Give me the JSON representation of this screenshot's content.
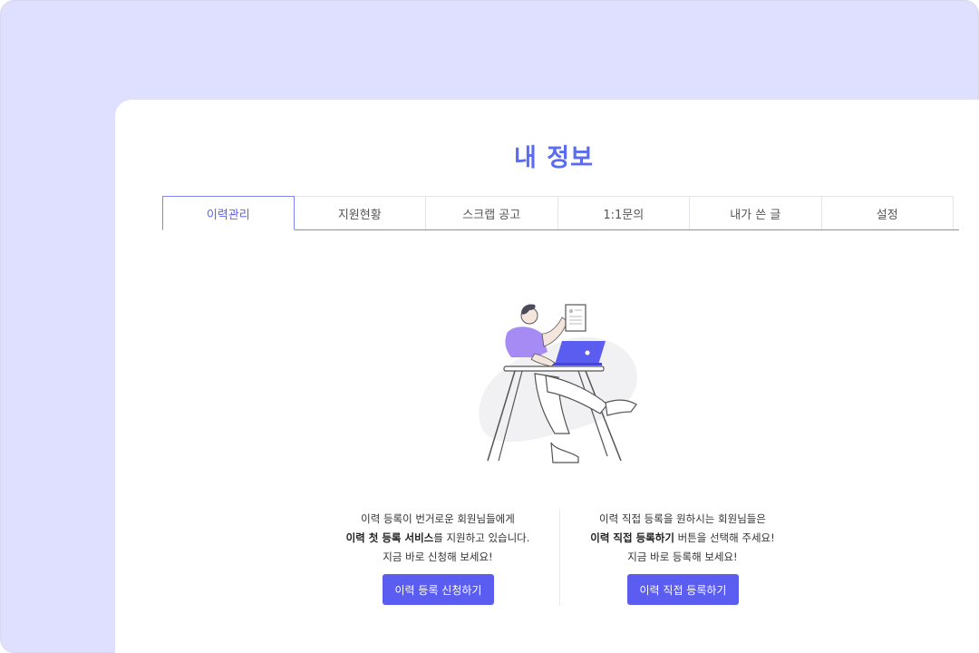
{
  "page": {
    "title": "내 정보"
  },
  "tabs": [
    {
      "label": "이력관리",
      "active": true
    },
    {
      "label": "지원현황",
      "active": false
    },
    {
      "label": "스크랩 공고",
      "active": false
    },
    {
      "label": "1:1문의",
      "active": false
    },
    {
      "label": "내가 쓴 글",
      "active": false
    },
    {
      "label": "설정",
      "active": false
    }
  ],
  "left_panel": {
    "line1": "이력 등록이 번거로운 회원님들에게",
    "line2_bold": "이력 첫 등록 서비스",
    "line2_rest": "를 지원하고 있습니다.",
    "line3": "지금 바로 신청해 보세요!",
    "button_label": "이력 등록 신청하기"
  },
  "right_panel": {
    "line1": "이력 직접 등록을 원하시는 회원님들은",
    "line2_bold": "이력 직접 등록하기",
    "line2_rest": " 버튼을 선택해 주세요!",
    "line3": "지금 바로 등록해 보세요!",
    "button_label": "이력 직접 등록하기"
  },
  "colors": {
    "accent": "#5b5cf0",
    "background": "#dfe0ff",
    "shirt": "#a78bf5"
  }
}
